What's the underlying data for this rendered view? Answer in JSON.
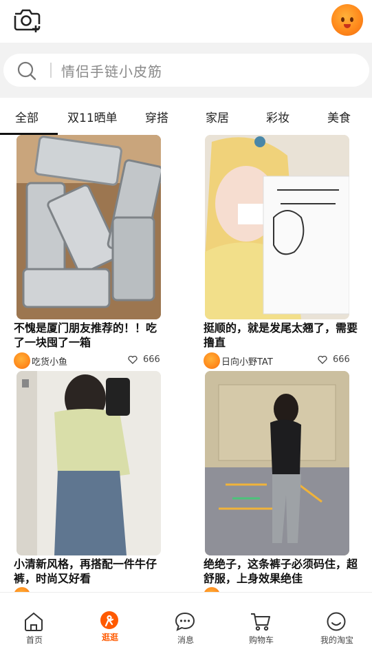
{
  "search": {
    "placeholder": "情侣手链小皮筋"
  },
  "tabs": [
    {
      "label": "全部"
    },
    {
      "label": "双11晒单"
    },
    {
      "label": "穿搭"
    },
    {
      "label": "家居"
    },
    {
      "label": "彩妆"
    },
    {
      "label": "美食"
    }
  ],
  "active_tab": "全部",
  "feed": [
    {
      "title": "不愧是厦门朋友推荐的！！吃了一块囤了一箱",
      "author": "吃货小鱼",
      "likes": "666"
    },
    {
      "title": "挺顺的，就是发尾太翘了，需要撸直",
      "author": "日向小野TAT",
      "likes": "666"
    },
    {
      "title": "小清新风格，再搭配一件牛仔裤，时尚又好看"
    },
    {
      "title": "绝绝子，这条裤子必须码住，超舒服，上身效果绝佳"
    }
  ],
  "colors": {
    "accent": "#ff5a00",
    "search_bg": "#f2f2f2"
  },
  "bottom_nav": [
    {
      "label": "首页",
      "icon": "home-icon"
    },
    {
      "label": "逛逛",
      "icon": "guangguang-icon",
      "active": true
    },
    {
      "label": "消息",
      "icon": "message-icon"
    },
    {
      "label": "购物车",
      "icon": "cart-icon"
    },
    {
      "label": "我的淘宝",
      "icon": "profile-icon"
    }
  ]
}
